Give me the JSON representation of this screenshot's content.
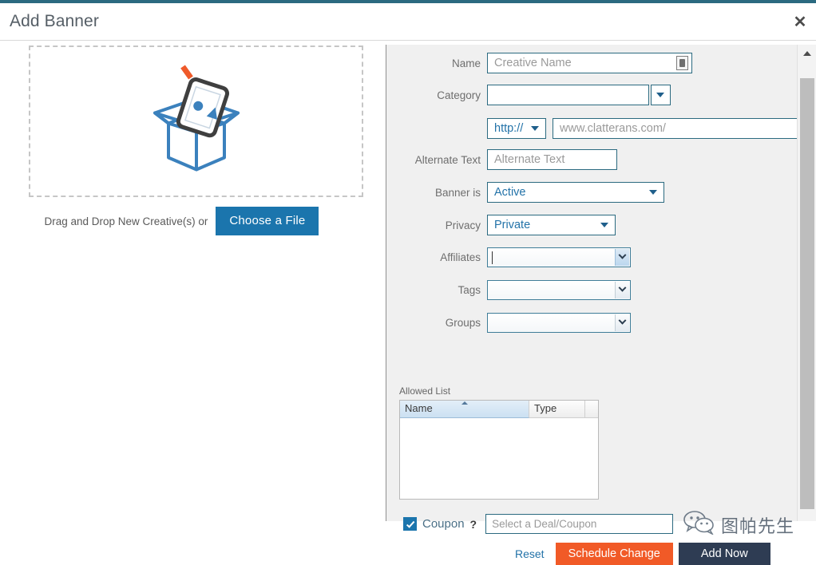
{
  "header": {
    "title": "Add Banner",
    "close_label": "✕"
  },
  "dropzone": {
    "caption": "Drag and Drop New Creative(s) or",
    "choose_file_label": "Choose a File"
  },
  "form": {
    "name": {
      "label": "Name",
      "placeholder": "Creative Name",
      "value": ""
    },
    "category": {
      "label": "Category",
      "value": ""
    },
    "url": {
      "protocol_value": "http://",
      "placeholder": "www.clatterans.com/",
      "value": ""
    },
    "alternate_text": {
      "label": "Alternate Text",
      "placeholder": "Alternate Text",
      "value": ""
    },
    "banner_is": {
      "label": "Banner is",
      "value": "Active"
    },
    "privacy": {
      "label": "Privacy",
      "value": "Private"
    },
    "affiliates": {
      "label": "Affiliates",
      "value": ""
    },
    "tags": {
      "label": "Tags",
      "value": ""
    },
    "groups": {
      "label": "Groups",
      "value": ""
    }
  },
  "allowed_list": {
    "label": "Allowed List",
    "columns": [
      "Name",
      "Type"
    ],
    "sorted_column": "Name",
    "sort_direction": "asc",
    "rows": []
  },
  "coupon": {
    "label": "Coupon",
    "checked": true,
    "help_label": "?",
    "placeholder": "Select a Deal/Coupon",
    "value": ""
  },
  "actions": {
    "reset_label": "Reset",
    "schedule_label": "Schedule Change",
    "add_now_label": "Add Now"
  },
  "watermark": {
    "text": "图帕先生"
  },
  "colors": {
    "accent_teal": "#2b6a80",
    "brand_blue": "#1b75ad",
    "orange": "#f15a27",
    "navy": "#2e3c53",
    "panel_bg": "#f0f0f0"
  }
}
